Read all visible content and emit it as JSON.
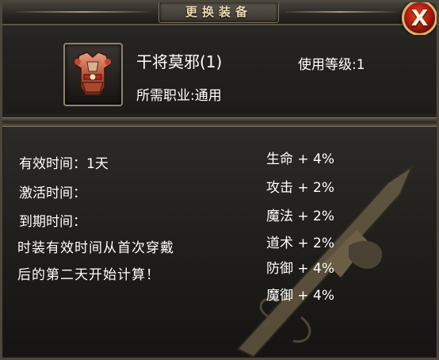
{
  "window": {
    "title": "更换装备"
  },
  "close_button": {
    "icon": "close-icon",
    "label": "X"
  },
  "item": {
    "name": "干将莫邪(1)",
    "required_level": "使用等级:1",
    "required_class": "所需职业:通用",
    "icon": "armor-icon"
  },
  "info": {
    "duration": "有效时间：1天",
    "activated": "激活时间：",
    "expires": "到期时间：",
    "note_line1": "时装有效时间从首次穿戴",
    "note_line2": "后的第二天开始计算！"
  },
  "stats": [
    {
      "label": "生命 + 4%"
    },
    {
      "label": "攻击 + 2%"
    },
    {
      "label": "魔法 + 2%"
    },
    {
      "label": "道术 + 2%"
    },
    {
      "label": "防御 + 4%"
    },
    {
      "label": "魔御 + 4%"
    }
  ],
  "colors": {
    "text": "#ffffff",
    "title": "#e8d7b0",
    "close_red": "#b01d12",
    "gold_border": "#d9b36b"
  }
}
